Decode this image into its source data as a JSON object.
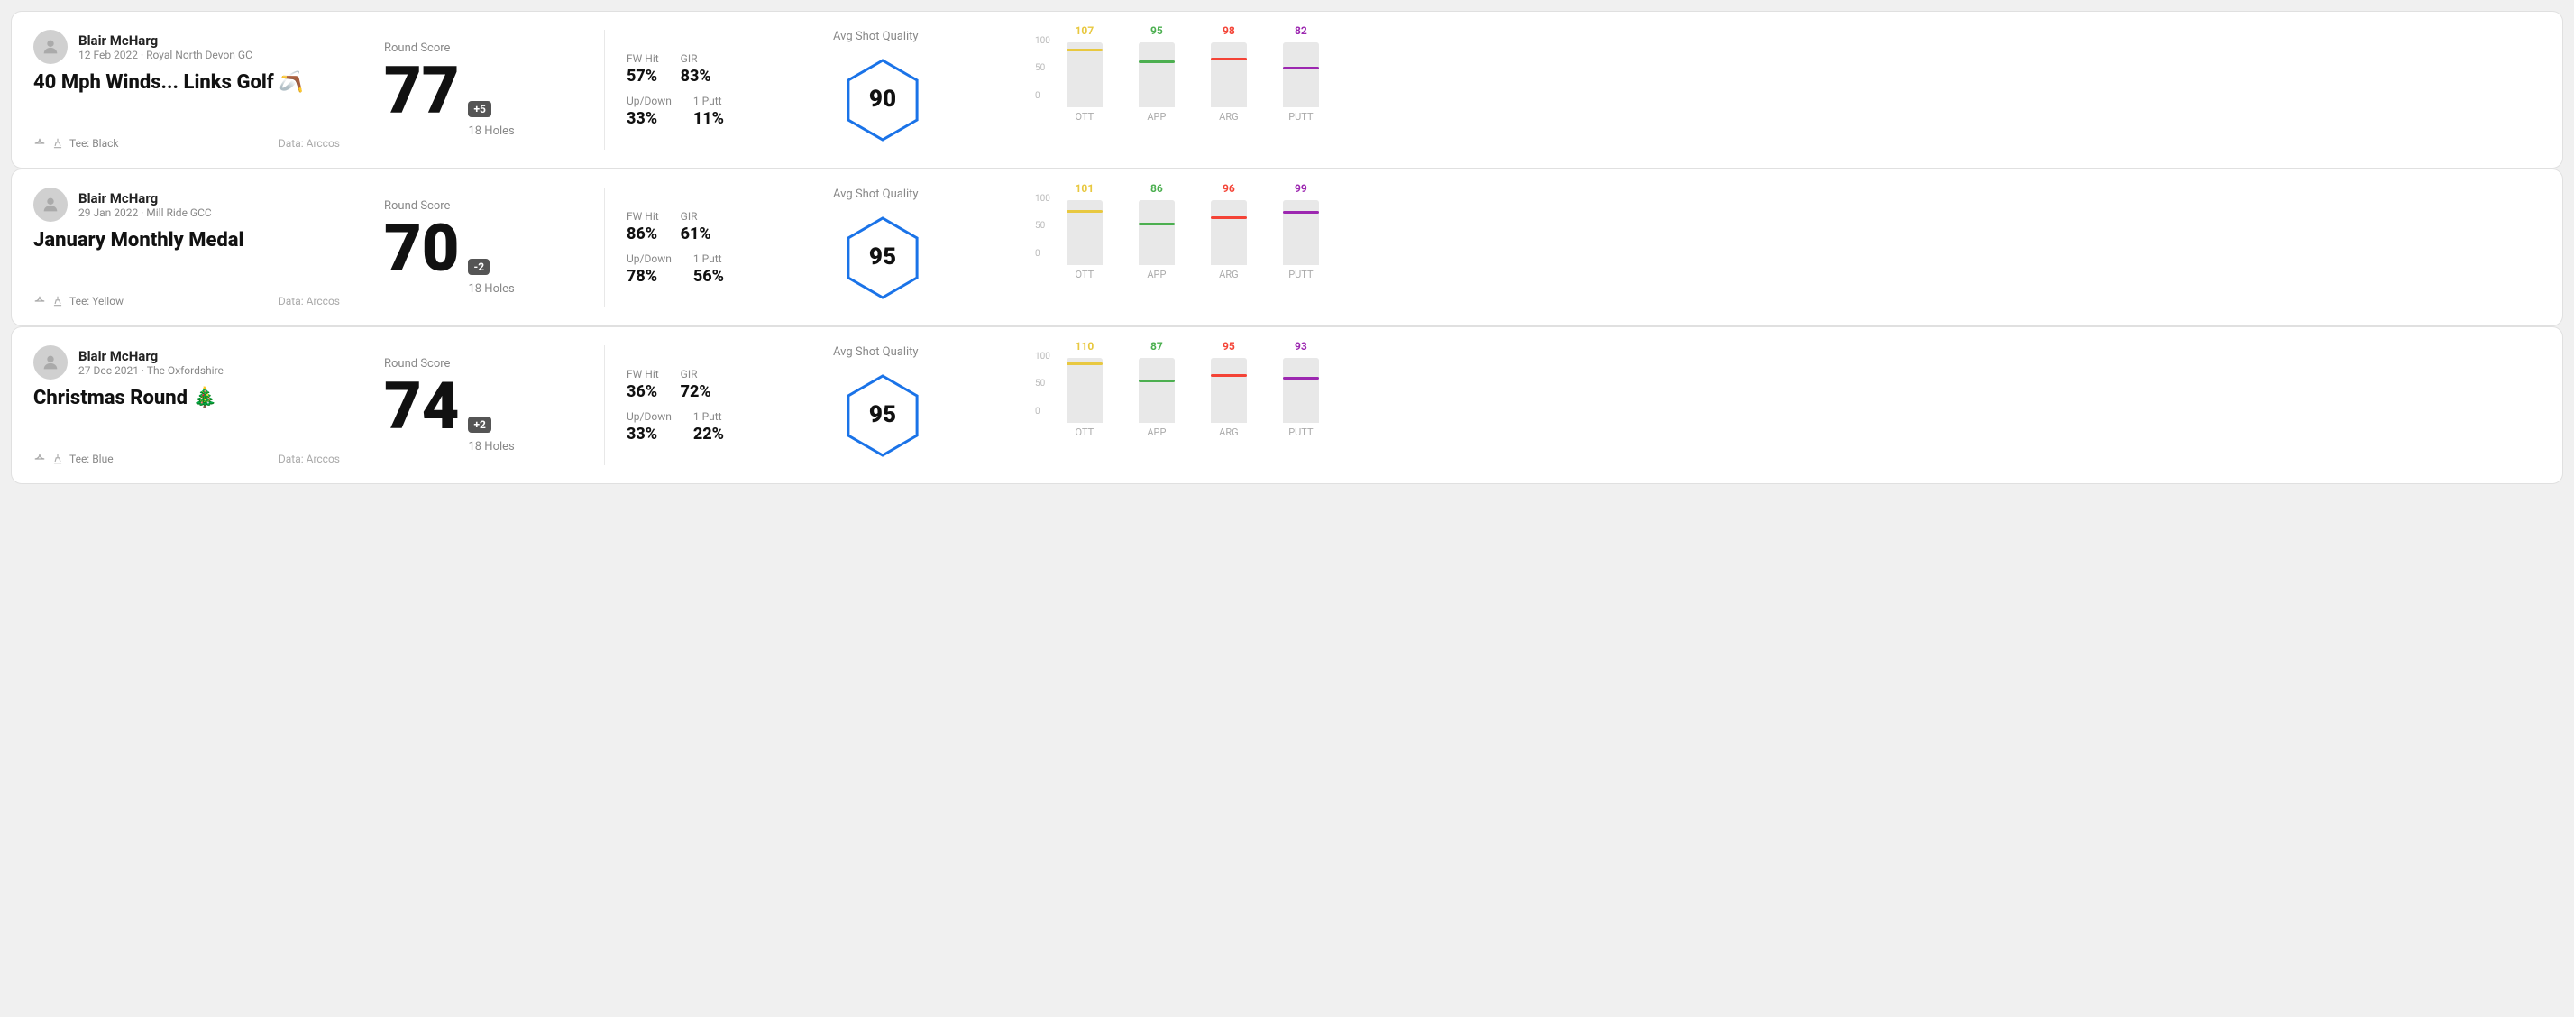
{
  "rounds": [
    {
      "id": "round-1",
      "player": "Blair McHarg",
      "date": "12 Feb 2022 · Royal North Devon GC",
      "title": "40 Mph Winds... Links Golf 🪃",
      "tee": "Tee: Black",
      "data_source": "Data: Arccos",
      "score": "77",
      "score_diff": "+5",
      "holes": "18 Holes",
      "fw_hit": "57%",
      "gir": "83%",
      "up_down": "33%",
      "one_putt": "11%",
      "avg_quality": "90",
      "chart": {
        "ott": {
          "value": 107,
          "color": "#e8c840",
          "pct": 85
        },
        "app": {
          "value": 95,
          "color": "#4caf50",
          "pct": 68
        },
        "arg": {
          "value": 98,
          "color": "#f44336",
          "pct": 72
        },
        "putt": {
          "value": 82,
          "color": "#9c27b0",
          "pct": 58
        }
      }
    },
    {
      "id": "round-2",
      "player": "Blair McHarg",
      "date": "29 Jan 2022 · Mill Ride GCC",
      "title": "January Monthly Medal",
      "tee": "Tee: Yellow",
      "data_source": "Data: Arccos",
      "score": "70",
      "score_diff": "-2",
      "holes": "18 Holes",
      "fw_hit": "86%",
      "gir": "61%",
      "up_down": "78%",
      "one_putt": "56%",
      "avg_quality": "95",
      "chart": {
        "ott": {
          "value": 101,
          "color": "#e8c840",
          "pct": 80
        },
        "app": {
          "value": 86,
          "color": "#4caf50",
          "pct": 60
        },
        "arg": {
          "value": 96,
          "color": "#f44336",
          "pct": 70
        },
        "putt": {
          "value": 99,
          "color": "#9c27b0",
          "pct": 78
        }
      }
    },
    {
      "id": "round-3",
      "player": "Blair McHarg",
      "date": "27 Dec 2021 · The Oxfordshire",
      "title": "Christmas Round 🎄",
      "tee": "Tee: Blue",
      "data_source": "Data: Arccos",
      "score": "74",
      "score_diff": "+2",
      "holes": "18 Holes",
      "fw_hit": "36%",
      "gir": "72%",
      "up_down": "33%",
      "one_putt": "22%",
      "avg_quality": "95",
      "chart": {
        "ott": {
          "value": 110,
          "color": "#e8c840",
          "pct": 88
        },
        "app": {
          "value": 87,
          "color": "#4caf50",
          "pct": 62
        },
        "arg": {
          "value": 95,
          "color": "#f44336",
          "pct": 70
        },
        "putt": {
          "value": 93,
          "color": "#9c27b0",
          "pct": 66
        }
      }
    }
  ],
  "labels": {
    "round_score": "Round Score",
    "fw_hit": "FW Hit",
    "gir": "GIR",
    "up_down": "Up/Down",
    "one_putt": "1 Putt",
    "avg_quality": "Avg Shot Quality",
    "ott": "OTT",
    "app": "APP",
    "arg": "ARG",
    "putt": "PUTT",
    "y100": "100",
    "y50": "50",
    "y0": "0"
  }
}
